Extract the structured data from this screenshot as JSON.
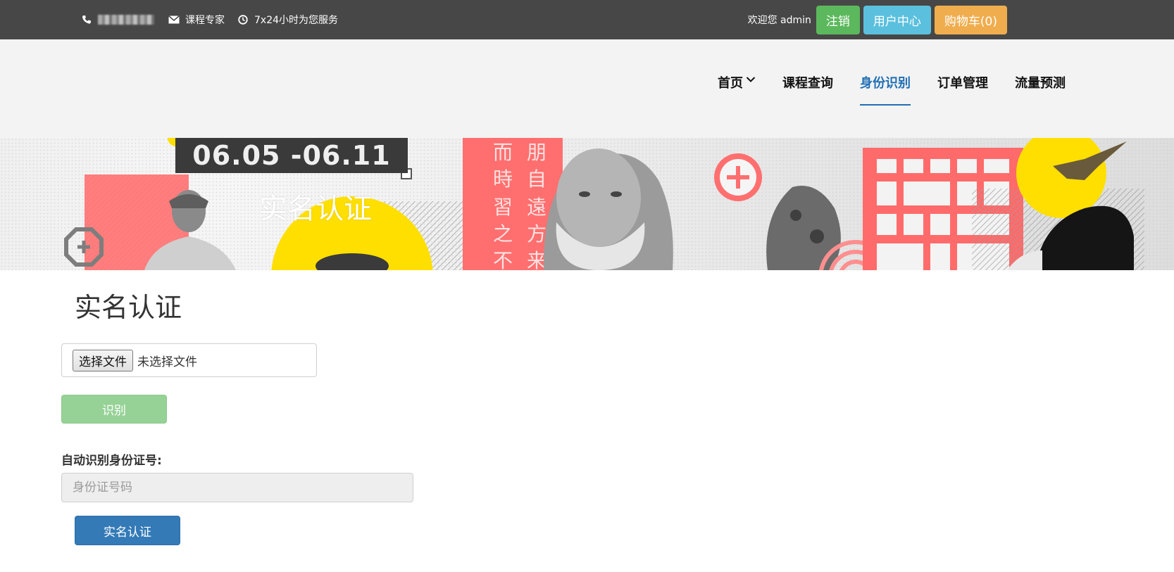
{
  "topbar": {
    "phone_icon": "phone-icon",
    "mail_icon": "envelope-icon",
    "clock_icon": "clock-icon",
    "email_text": "课程专家",
    "service_text": "7x24小时为您服务",
    "welcome_text": "欢迎您 admin",
    "logout_label": "注销",
    "user_center_label": "用户中心",
    "cart_label": "购物车(0)"
  },
  "nav": {
    "items": [
      {
        "label": "首页"
      },
      {
        "label": "课程查询"
      },
      {
        "label": "身份识别"
      },
      {
        "label": "订单管理"
      },
      {
        "label": "流量预测"
      }
    ],
    "active_color": "#1f6fb5"
  },
  "banner": {
    "date_text": "06.05 -06.11",
    "title": "实名认证"
  },
  "main": {
    "page_title": "实名认证",
    "file_button_label": "选择文件",
    "file_status": "未选择文件",
    "recognize_label": "识别",
    "id_label": "自动识别身份证号:",
    "id_placeholder": "身份证号码",
    "verify_label": "实名认证"
  },
  "colors": {
    "topbar_bg": "#474747",
    "header_bg": "#f3f3f3",
    "success": "#5cb85c",
    "info": "#5bc0de",
    "warning": "#f0ad4e",
    "primary": "#337ab7"
  }
}
